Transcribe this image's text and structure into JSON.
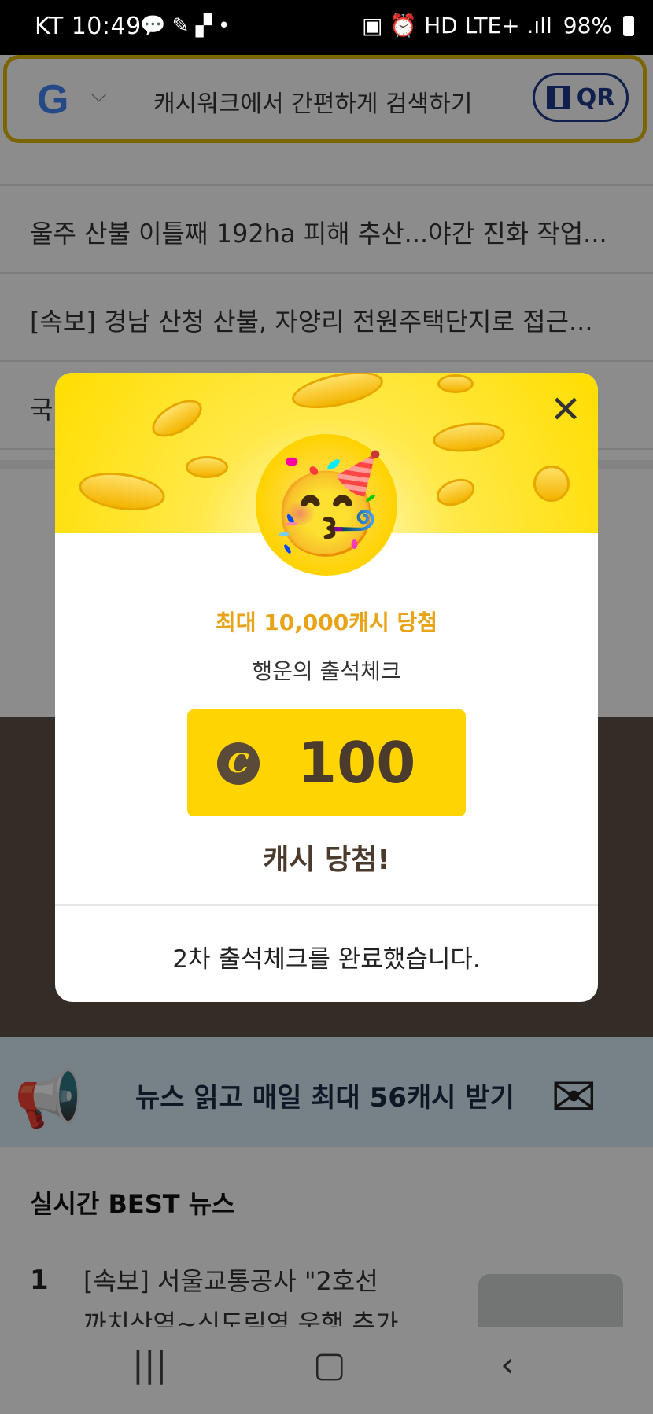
{
  "status_bar": {
    "time": "KT 10:49",
    "left_icons": "💬 ✎ ▞ •",
    "right_icons": "▣ ⏰ HD LTE+ .ıll",
    "battery": "98%"
  },
  "search": {
    "engine_logo": "G",
    "placeholder": "캐시워크에서 간편하게 검색하기",
    "qr_label": "QR"
  },
  "news_list": [
    "울주 산불 이틀째 192ha 피해 추산...야간 진화 작업...",
    "[속보] 경남 산청 산불, 자양리 전원주택단지로 접근...",
    "국..."
  ],
  "banner": {
    "text": "뉴스 읽고 매일 최대 56캐시 받기"
  },
  "best_news": {
    "title": "실시간 BEST 뉴스",
    "item1_rank": "1",
    "item1_line1": "[속보] 서울교통공사 \"2호선",
    "item1_line2": "까치산역~신도림역 운행 추가 ..."
  },
  "modal": {
    "subtitle": "최대 10,000캐시 당첨",
    "title": "행운의 출석체크",
    "prize_icon": "C",
    "prize_amount": "100",
    "won_text": "캐시 당첨!",
    "footer_text": "2차 출석체크를 완료했습니다.",
    "emoji": "🥳"
  },
  "colors": {
    "accent_yellow": "#ffd400",
    "subtitle_orange": "#e8a317",
    "text_brown": "#4b3b2d"
  }
}
